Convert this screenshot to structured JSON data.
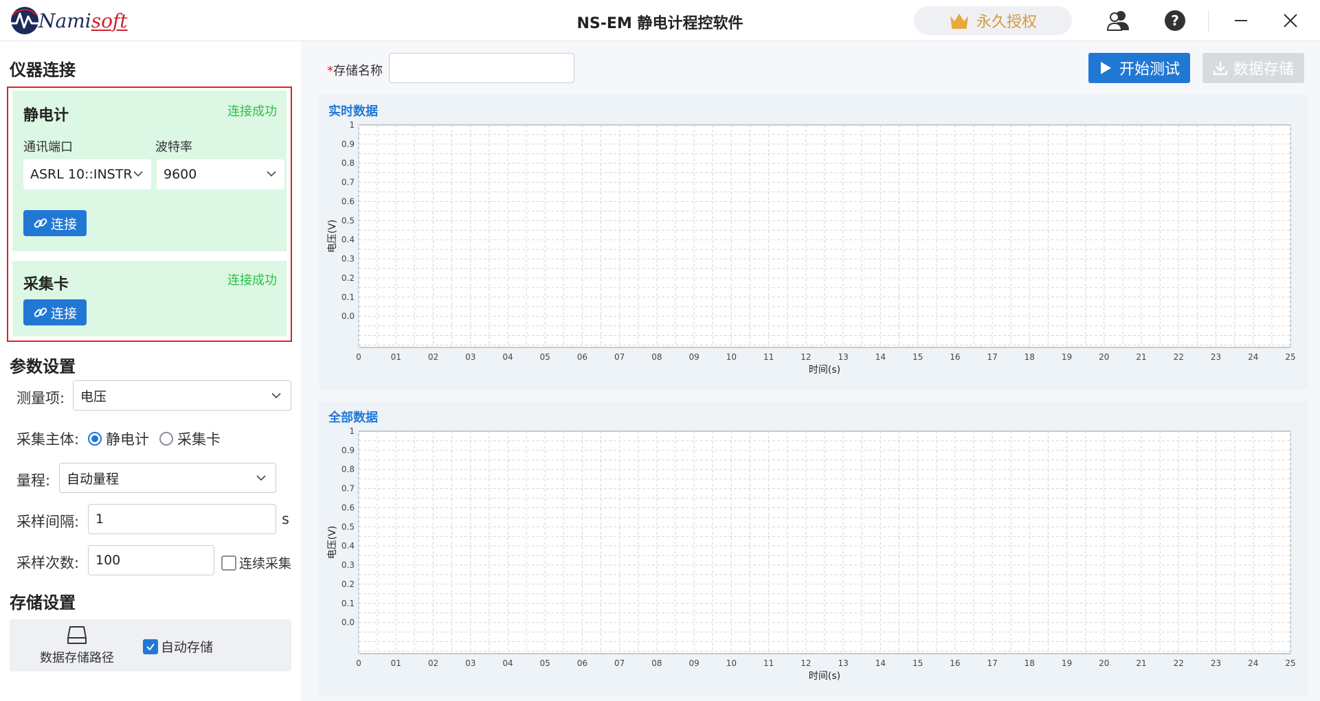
{
  "window": {
    "brand_prefix": "Nami",
    "brand_suffix": "soft",
    "title": "NS-EM 静电计程控软件",
    "license_label": "永久授权",
    "icons": [
      "crown-icon",
      "users-icon",
      "help-icon",
      "minimize-icon",
      "close-icon"
    ]
  },
  "connection": {
    "section_title": "仪器连接",
    "electrometer": {
      "name": "静电计",
      "status": "连接成功",
      "port_label": "通讯端口",
      "port_value": "ASRL 10::INSTR",
      "baud_label": "波特率",
      "baud_value": "9600",
      "connect_label": "连接"
    },
    "daq": {
      "name": "采集卡",
      "status": "连接成功",
      "connect_label": "连接"
    },
    "status_color": "#2fbf4a"
  },
  "params": {
    "section_title": "参数设置",
    "measure_label": "测量项:",
    "measure_value": "电压",
    "subject_label": "采集主体:",
    "subject_options": [
      "静电计",
      "采集卡"
    ],
    "subject_selected": "静电计",
    "range_label": "量程:",
    "range_value": "自动量程",
    "interval_label": "采样间隔:",
    "interval_value": "1",
    "interval_unit": "s",
    "count_label": "采样次数:",
    "count_value": "100",
    "continuous_label": "连续采集",
    "continuous_checked": false
  },
  "storage": {
    "section_title": "存储设置",
    "path_label": "数据存储路径",
    "auto_label": "自动存储",
    "auto_checked": true
  },
  "toolbar": {
    "required_mark": "*",
    "name_label": "存储名称",
    "name_value": "",
    "start_label": "开始测试",
    "save_label": "数据存储",
    "accent_color": "#2178d4"
  },
  "chart_data": [
    {
      "type": "line",
      "title": "实时数据",
      "xlabel": "时间(s)",
      "ylabel": "电压(V)",
      "x_ticks": [
        "0",
        "01",
        "02",
        "03",
        "04",
        "05",
        "06",
        "07",
        "08",
        "09",
        "10",
        "11",
        "12",
        "13",
        "14",
        "15",
        "16",
        "17",
        "18",
        "19",
        "20",
        "21",
        "22",
        "23",
        "24",
        "25"
      ],
      "y_ticks": [
        "0.0",
        "0.1",
        "0.2",
        "0.3",
        "0.4",
        "0.5",
        "0.6",
        "0.7",
        "0.8",
        "0.9",
        "1"
      ],
      "xlim": [
        0,
        25
      ],
      "ylim": [
        0,
        1
      ],
      "grid": true,
      "series": []
    },
    {
      "type": "line",
      "title": "全部数据",
      "xlabel": "时间(s)",
      "ylabel": "电压(V)",
      "x_ticks": [
        "0",
        "01",
        "02",
        "03",
        "04",
        "05",
        "06",
        "07",
        "08",
        "09",
        "10",
        "11",
        "12",
        "13",
        "14",
        "15",
        "16",
        "17",
        "18",
        "19",
        "20",
        "21",
        "22",
        "23",
        "24",
        "25"
      ],
      "y_ticks": [
        "0.0",
        "0.1",
        "0.2",
        "0.3",
        "0.4",
        "0.5",
        "0.6",
        "0.7",
        "0.8",
        "0.9",
        "1"
      ],
      "xlim": [
        0,
        25
      ],
      "ylim": [
        0,
        1
      ],
      "grid": true,
      "series": []
    }
  ]
}
